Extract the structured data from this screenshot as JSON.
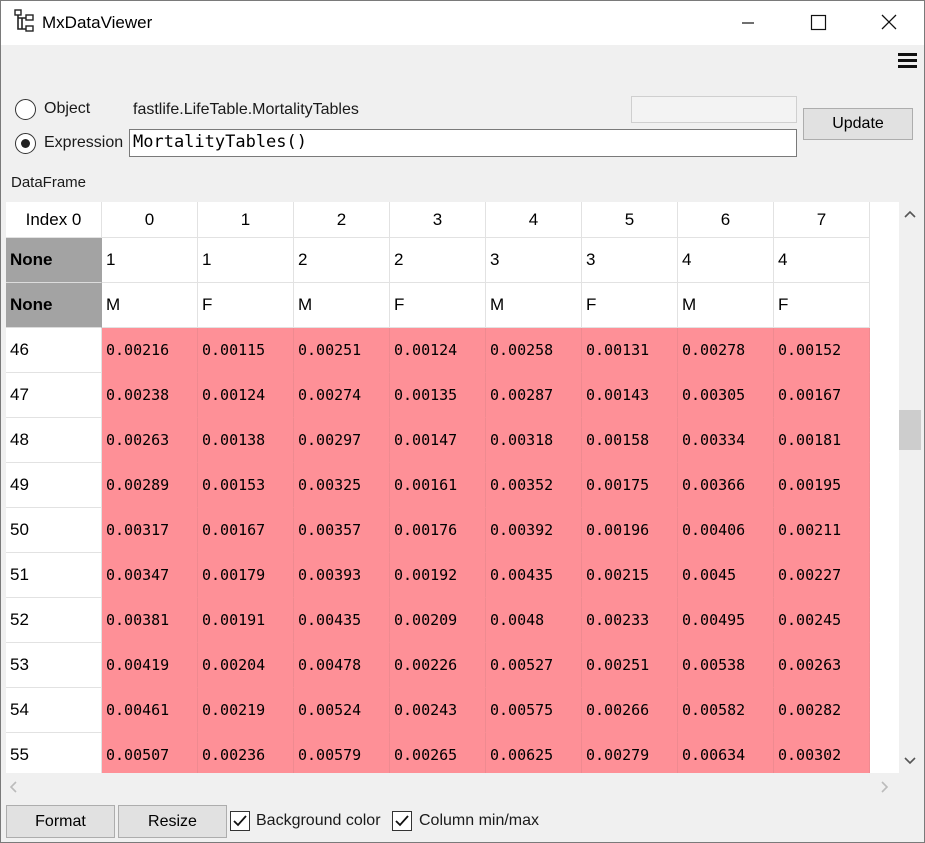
{
  "window": {
    "title": "MxDataViewer",
    "icons": {
      "app": "tree-icon",
      "minimize": "minimize-icon",
      "maximize": "maximize-icon",
      "close": "close-icon",
      "menu": "hamburger-menu-icon"
    }
  },
  "source": {
    "object_label": "Object",
    "object_value": "fastlife.LifeTable.MortalityTables",
    "expression_label": "Expression",
    "expression_value": "MortalityTables()",
    "selected": "expression",
    "update_label": "Update"
  },
  "data_label": "DataFrame",
  "table": {
    "corner_label": "Index 0",
    "columns": [
      "0",
      "1",
      "2",
      "3",
      "4",
      "5",
      "6",
      "7"
    ],
    "column_levels": [
      {
        "name": "None",
        "values": [
          "1",
          "1",
          "2",
          "2",
          "3",
          "3",
          "4",
          "4"
        ]
      },
      {
        "name": "None",
        "values": [
          "M",
          "F",
          "M",
          "F",
          "M",
          "F",
          "M",
          "F"
        ]
      }
    ],
    "rows": [
      {
        "index": "46",
        "values": [
          "0.00216",
          "0.00115",
          "0.00251",
          "0.00124",
          "0.00258",
          "0.00131",
          "0.00278",
          "0.00152"
        ]
      },
      {
        "index": "47",
        "values": [
          "0.00238",
          "0.00124",
          "0.00274",
          "0.00135",
          "0.00287",
          "0.00143",
          "0.00305",
          "0.00167"
        ]
      },
      {
        "index": "48",
        "values": [
          "0.00263",
          "0.00138",
          "0.00297",
          "0.00147",
          "0.00318",
          "0.00158",
          "0.00334",
          "0.00181"
        ]
      },
      {
        "index": "49",
        "values": [
          "0.00289",
          "0.00153",
          "0.00325",
          "0.00161",
          "0.00352",
          "0.00175",
          "0.00366",
          "0.00195"
        ]
      },
      {
        "index": "50",
        "values": [
          "0.00317",
          "0.00167",
          "0.00357",
          "0.00176",
          "0.00392",
          "0.00196",
          "0.00406",
          "0.00211"
        ]
      },
      {
        "index": "51",
        "values": [
          "0.00347",
          "0.00179",
          "0.00393",
          "0.00192",
          "0.00435",
          "0.00215",
          "0.0045",
          "0.00227"
        ]
      },
      {
        "index": "52",
        "values": [
          "0.00381",
          "0.00191",
          "0.00435",
          "0.00209",
          "0.0048",
          "0.00233",
          "0.00495",
          "0.00245"
        ]
      },
      {
        "index": "53",
        "values": [
          "0.00419",
          "0.00204",
          "0.00478",
          "0.00226",
          "0.00527",
          "0.00251",
          "0.00538",
          "0.00263"
        ]
      },
      {
        "index": "54",
        "values": [
          "0.00461",
          "0.00219",
          "0.00524",
          "0.00243",
          "0.00575",
          "0.00266",
          "0.00582",
          "0.00282"
        ]
      },
      {
        "index": "55",
        "values": [
          "0.00507",
          "0.00236",
          "0.00579",
          "0.00265",
          "0.00625",
          "0.00279",
          "0.00634",
          "0.00302"
        ]
      }
    ],
    "colors": {
      "value_bg": "#fe9097",
      "level_header_bg": "#a3a3a3"
    }
  },
  "footer": {
    "format_label": "Format",
    "resize_label": "Resize",
    "background_color_label": "Background color",
    "background_color_checked": true,
    "column_minmax_label": "Column min/max",
    "column_minmax_checked": true
  }
}
